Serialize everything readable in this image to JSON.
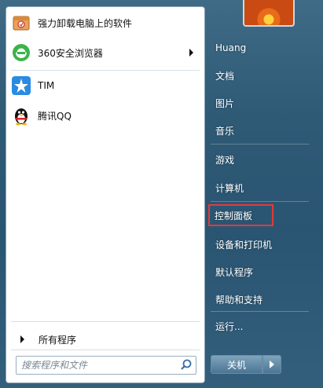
{
  "programs": [
    {
      "label": "强力卸载电脑上的软件",
      "icon": "uninstaller-box-icon",
      "has_submenu": false
    },
    {
      "label": "360安全浏览器",
      "icon": "360-browser-icon",
      "has_submenu": true
    },
    {
      "label": "TIM",
      "icon": "tim-star-icon",
      "has_submenu": false
    },
    {
      "label": "腾讯QQ",
      "icon": "qq-penguin-icon",
      "has_submenu": false
    }
  ],
  "all_programs_label": "所有程序",
  "search": {
    "placeholder": "搜索程序和文件"
  },
  "right_menu": [
    {
      "label": "Huang"
    },
    {
      "label": "文档"
    },
    {
      "label": "图片"
    },
    {
      "label": "音乐"
    },
    {
      "label": "游戏"
    },
    {
      "label": "计算机"
    },
    {
      "label": "控制面板"
    },
    {
      "label": "设备和打印机"
    },
    {
      "label": "默认程序"
    },
    {
      "label": "帮助和支持"
    },
    {
      "label": "运行..."
    }
  ],
  "shutdown_label": "关机",
  "colors": {
    "highlight": "#e23a3a",
    "taskbar_blue": "#2f5a76"
  }
}
